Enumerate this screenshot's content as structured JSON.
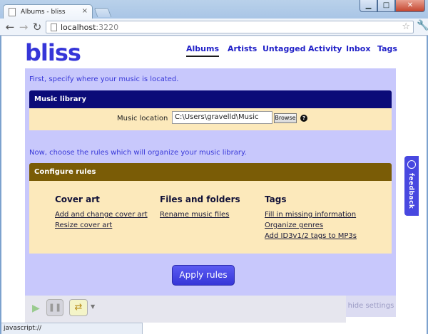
{
  "browser": {
    "tab_title": "Albums - bliss",
    "tab_close": "×",
    "url_host": "localhost",
    "url_port": ":3220",
    "status_text": "javascript://"
  },
  "app": {
    "logo": "bliss",
    "nav": [
      "Albums",
      "Artists",
      "Untagged",
      "Activity",
      "Inbox",
      "Tags"
    ],
    "active_nav": "Albums"
  },
  "settings": {
    "intro_location": "First, specify where your music is located.",
    "music_library": {
      "title": "Music library",
      "location_label": "Music location",
      "location_value": "C:\\Users\\gravelld\\Music",
      "browse_label": "Browse",
      "help_glyph": "?"
    },
    "intro_rules": "Now, choose the rules which will organize your music library.",
    "configure_rules": {
      "title": "Configure rules",
      "columns": [
        {
          "heading": "Cover art",
          "links": [
            "Add and change cover art",
            "Resize cover art"
          ]
        },
        {
          "heading": "Files and folders",
          "links": [
            "Rename music files"
          ]
        },
        {
          "heading": "Tags",
          "links": [
            "Fill in missing information",
            "Organize genres",
            "Add ID3v1/2 tags to MP3s"
          ]
        }
      ]
    },
    "apply_label": "Apply rules"
  },
  "feedback_label": "feedback",
  "hide_settings_label": "hide settings",
  "colors": {
    "library_header": "#0b0b78",
    "rules_header": "#7a5c06",
    "panel_body": "#fce9bb",
    "settings_bg": "#c8c8fc",
    "accent": "#3535d8"
  },
  "icons": [
    "page-icon",
    "back-arrow-icon",
    "forward-arrow-icon",
    "reload-icon",
    "star-icon",
    "wrench-icon",
    "help-icon",
    "megaphone-icon",
    "play-icon",
    "pause-icon",
    "shuffle-icon"
  ]
}
